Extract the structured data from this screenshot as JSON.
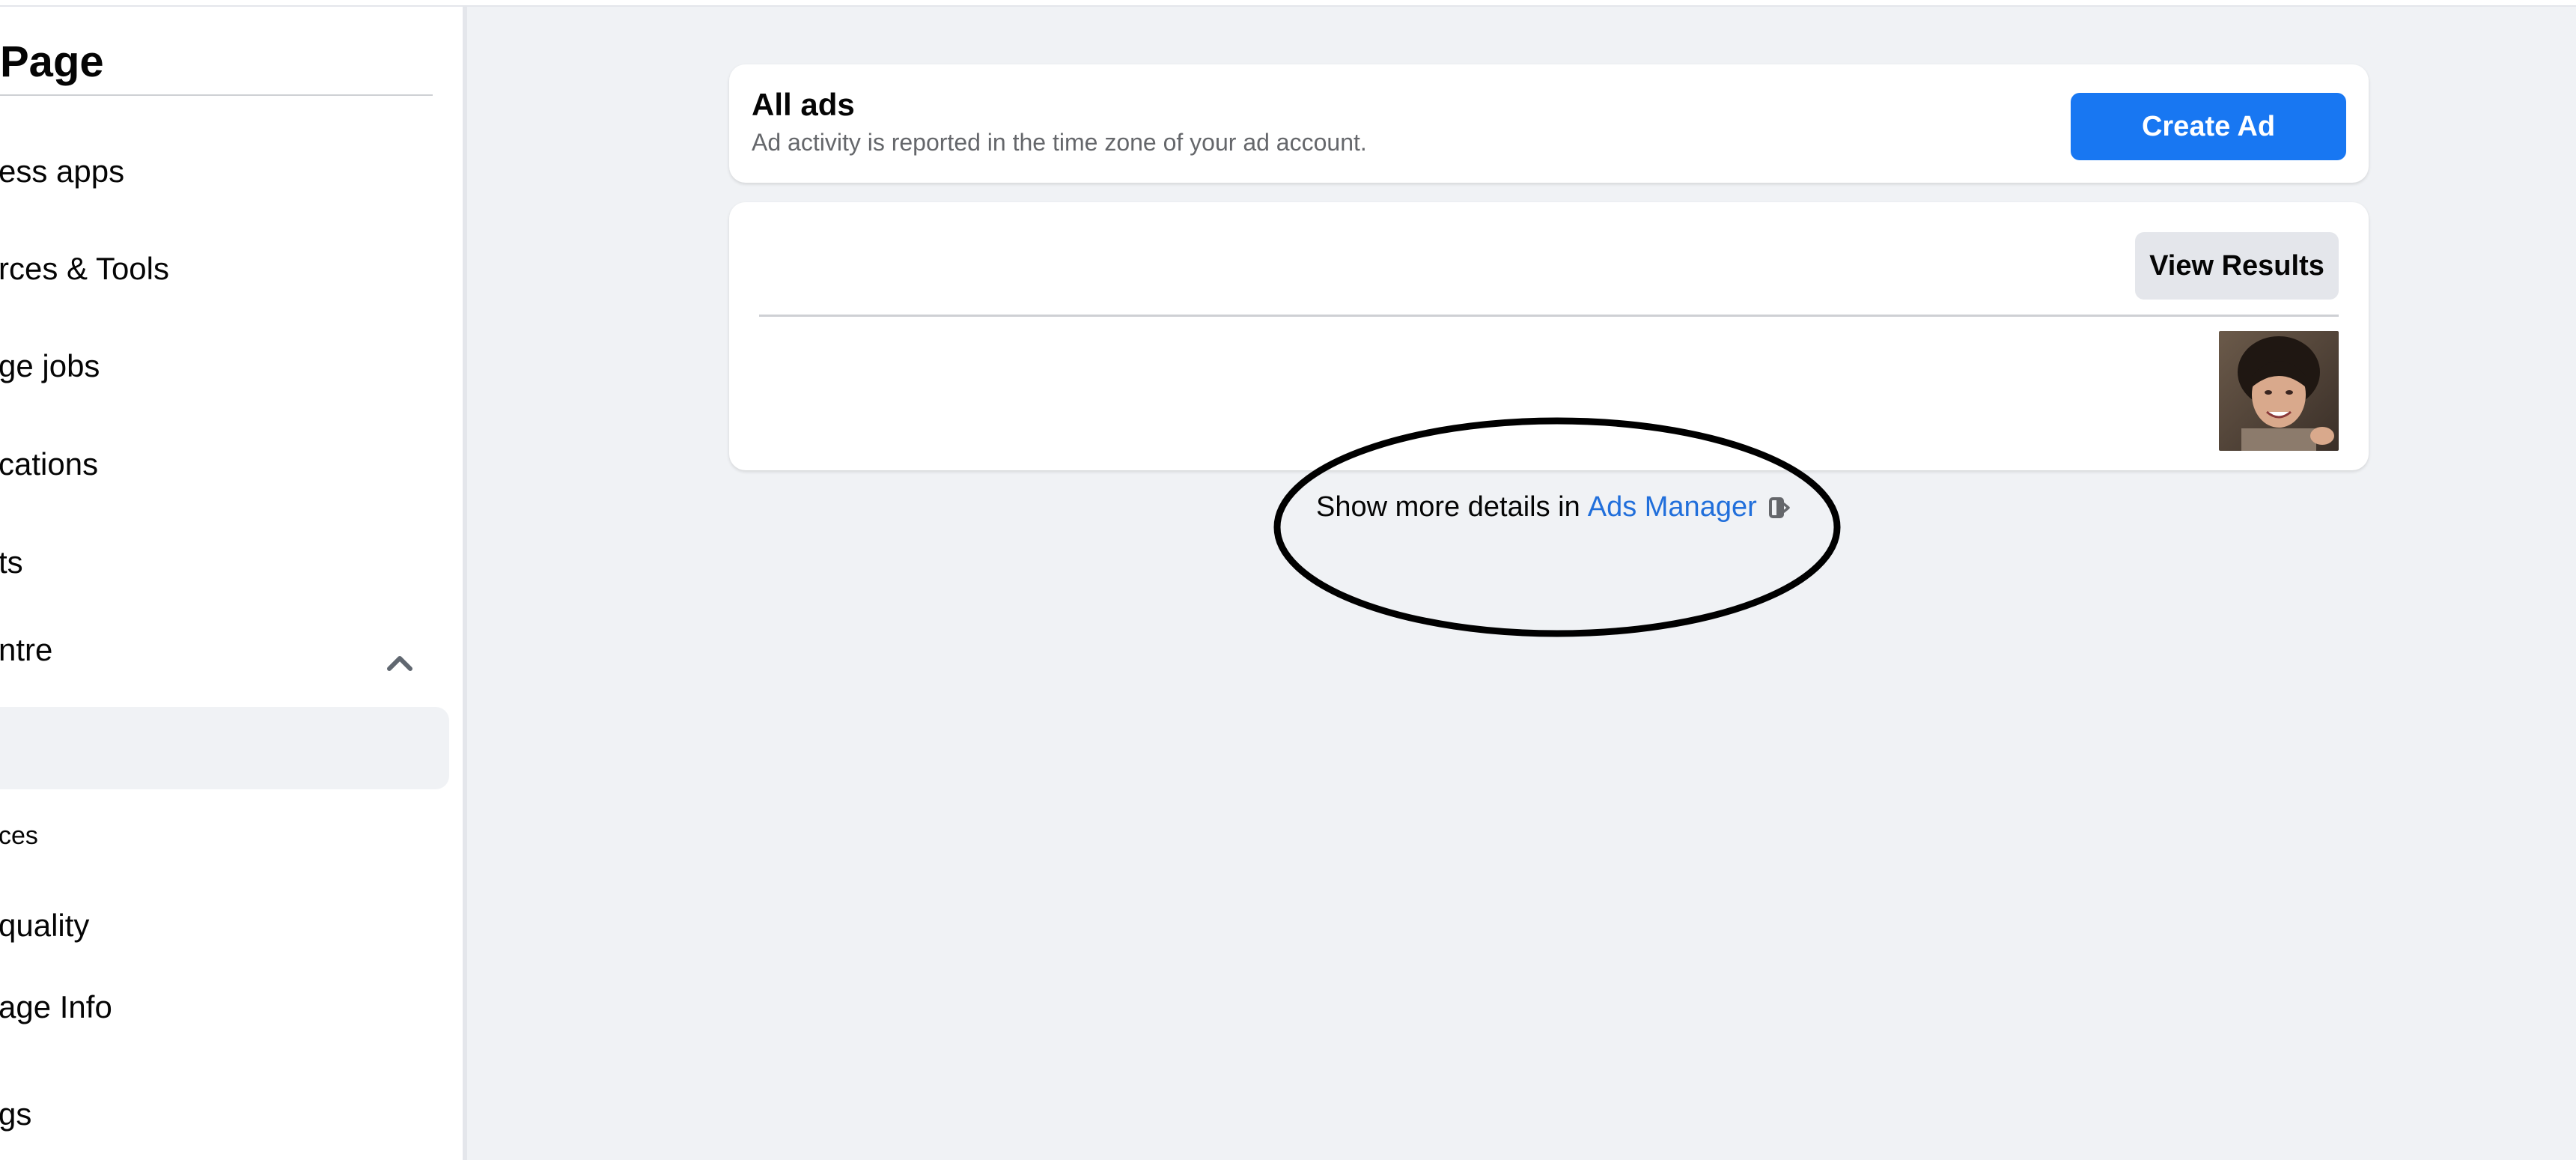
{
  "sidebar": {
    "title": "Page",
    "items": [
      {
        "label": "ess apps"
      },
      {
        "label": "rces & Tools"
      },
      {
        "label": "ge jobs"
      },
      {
        "label": "cations"
      },
      {
        "label": "ts"
      },
      {
        "label": "ntre"
      },
      {
        "label": ""
      },
      {
        "label": "ces"
      },
      {
        "label": "quality"
      },
      {
        "label": "age Info"
      },
      {
        "label": "gs"
      }
    ]
  },
  "header_card": {
    "title": "All ads",
    "subtitle": "Ad activity is reported in the time zone of your ad account.",
    "create_button": "Create Ad"
  },
  "results_card": {
    "view_results_button": "View Results"
  },
  "footer": {
    "prefix": "Show more details in",
    "link": "Ads Manager"
  },
  "colors": {
    "accent": "#1877f2",
    "link": "#216fdb",
    "background": "#f0f2f5"
  },
  "icons": {
    "chevron": "chevron-up-icon",
    "external": "external-link-icon"
  }
}
